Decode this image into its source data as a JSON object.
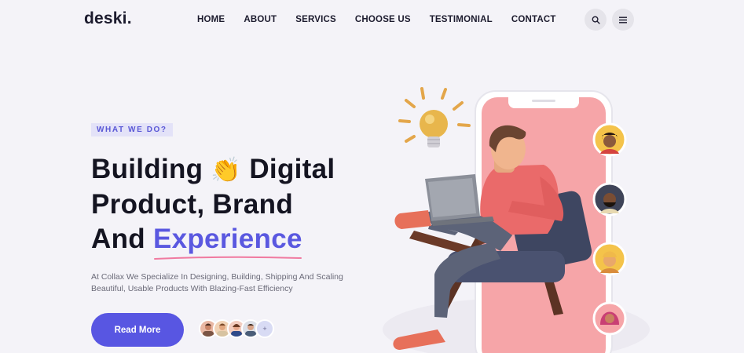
{
  "brand": {
    "logo": "deski."
  },
  "nav": {
    "items": [
      "HOME",
      "ABOUT",
      "SERVICS",
      "CHOOSE US",
      "TESTIMONIAL",
      "CONTACT"
    ],
    "search_icon": "search-icon",
    "menu_icon": "menu-icon"
  },
  "hero": {
    "badge": "WHAT WE DO?",
    "line1_a": "Building",
    "line1_emoji": "👏",
    "line1_b": "Digital",
    "line2": "Product, Brand",
    "line3_a": "And",
    "line3_accent": "Experience",
    "description_line1": "At Collax We Specialize In Designing, Building, Shipping And Scaling",
    "description_line2": "Beautiful, Usable Products With Blazing-Fast Efficiency",
    "cta_label": "Read More",
    "avatars_more": "+"
  },
  "colors": {
    "accent": "#5856e2",
    "badge_bg": "#e3e2f8",
    "phone_screen": "#f6a5a8",
    "underline": "#f07aa0"
  }
}
